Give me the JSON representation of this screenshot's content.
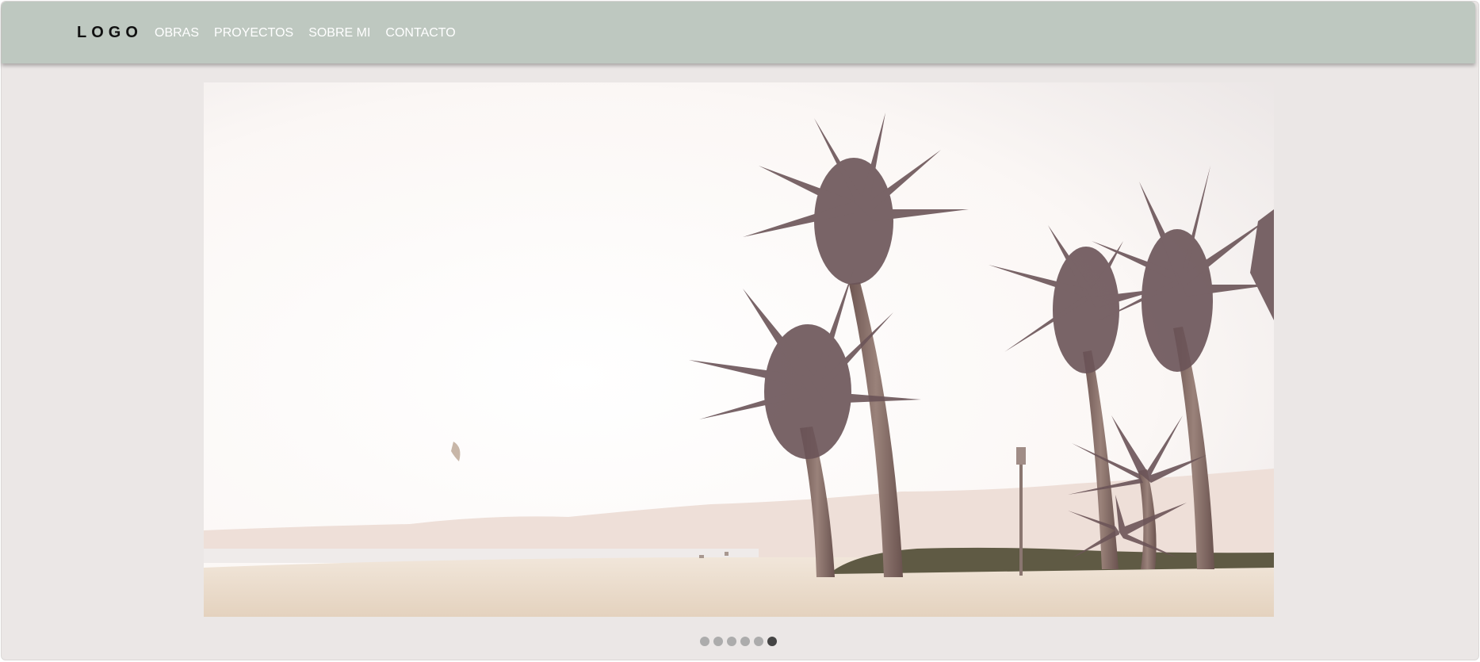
{
  "navbar": {
    "logo": "LOGO",
    "links": [
      "OBRAS",
      "PROYECTOS",
      "SOBRE MI",
      "CONTACTO"
    ]
  },
  "carousel": {
    "total_slides": 6,
    "active_index": 5
  },
  "colors": {
    "navbar_bg": "#bec8c0",
    "page_bg": "#ebe7e6",
    "dot_inactive": "#acacac",
    "dot_active": "#444444"
  }
}
